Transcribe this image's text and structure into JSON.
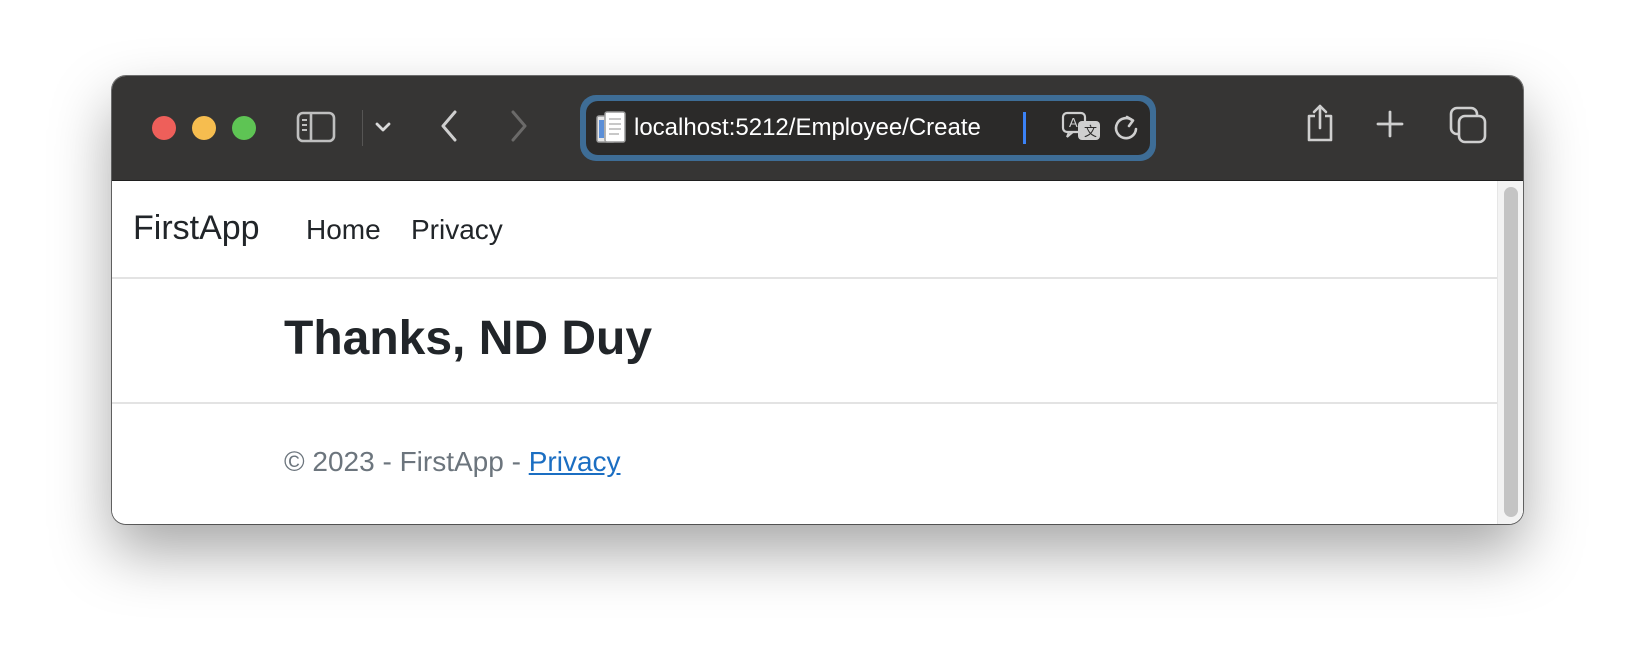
{
  "browser": {
    "url": "localhost:5212/Employee/Create",
    "icons": {
      "sidebar": "sidebar-icon",
      "sidebar_menu": "chevron-down-icon",
      "back": "chevron-left-icon",
      "forward": "chevron-right-icon",
      "page": "document-icon",
      "translate": "translate-icon",
      "reload": "reload-icon",
      "share": "share-icon",
      "new_tab": "plus-icon",
      "tabs": "tabs-overview-icon"
    },
    "colors": {
      "close": "#ee5f5a",
      "minimize": "#f6bd4f",
      "maximize": "#5ec454",
      "toolbar": "#363534",
      "focus_ring": "#3e6d96"
    }
  },
  "site": {
    "brand": "FirstApp",
    "nav": [
      {
        "label": "Home"
      },
      {
        "label": "Privacy"
      }
    ],
    "heading": "Thanks, ND Duy",
    "footer": {
      "text": "© 2023 - FirstApp - ",
      "link_label": "Privacy"
    },
    "colors": {
      "text": "#212529",
      "muted": "#6c757d",
      "link": "#1b6ec2"
    }
  }
}
